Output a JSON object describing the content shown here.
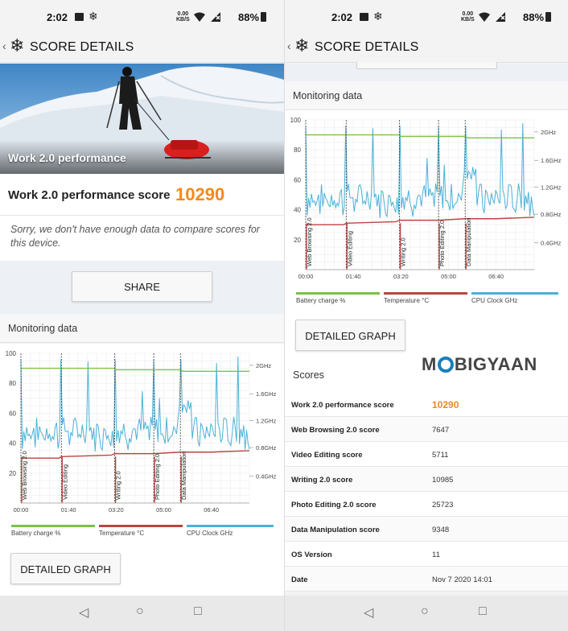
{
  "status": {
    "time": "2:02",
    "netspeed_top": "0.00",
    "netspeed_bottom": "KB/S",
    "battery": "88%"
  },
  "toolbar": {
    "title": "SCORE DETAILS"
  },
  "left": {
    "hero_caption": "Work 2.0 performance",
    "score_label": "Work 2.0 performance score",
    "score_value": "10290",
    "sorry_text": "Sorry, we don't have enough data to compare scores for this device.",
    "share_label": "SHARE",
    "monitoring_title": "Monitoring data",
    "detailed_graph_label": "DETAILED GRAPH"
  },
  "right": {
    "monitoring_title": "Monitoring data",
    "detailed_graph_label": "DETAILED GRAPH",
    "scores_title": "Scores",
    "watermark_left": "M",
    "watermark_right": "BIGYAAN",
    "rows": [
      {
        "key": "Work 2.0 performance score",
        "value": "10290"
      },
      {
        "key": "Web Browsing 2.0 score",
        "value": "7647"
      },
      {
        "key": "Video Editing score",
        "value": "5711"
      },
      {
        "key": "Writing 2.0 score",
        "value": "10985"
      },
      {
        "key": "Photo Editing 2.0 score",
        "value": "25723"
      },
      {
        "key": "Data Manipulation score",
        "value": "9348"
      },
      {
        "key": "OS Version",
        "value": "11"
      },
      {
        "key": "Date",
        "value": "Nov 7 2020 14:01"
      }
    ]
  },
  "chart_data": {
    "type": "line",
    "yticks_left": [
      "100",
      "80",
      "60",
      "40",
      "20"
    ],
    "yticks_right": [
      "2GHz",
      "1.6GHz",
      "1.2GHz",
      "0.8GHz",
      "0.4GHz"
    ],
    "xticks": [
      "00:00",
      "01:40",
      "03:20",
      "05:00",
      "06:40"
    ],
    "ylim": [
      0,
      100
    ],
    "xlim": [
      0,
      480
    ],
    "legend": [
      "Battery charge %",
      "Temperature °C",
      "CPU Clock GHz"
    ],
    "colors": {
      "battery": "#7cc246",
      "temperature": "#b94642",
      "cpu": "#4ab1d8"
    },
    "markers": [
      {
        "label": "Web Browsing 2.0",
        "x": 0
      },
      {
        "label": "Video Editing",
        "x": 85
      },
      {
        "label": "Writing 2.0",
        "x": 197
      },
      {
        "label": "Photo Editing 2.0",
        "x": 279
      },
      {
        "label": "Data Manipulation",
        "x": 335
      }
    ],
    "series": [
      {
        "name": "Battery charge %",
        "values": [
          [
            0,
            90
          ],
          [
            80,
            90
          ],
          [
            85,
            90
          ],
          [
            197,
            90
          ],
          [
            200,
            89
          ],
          [
            335,
            89
          ],
          [
            340,
            88
          ],
          [
            480,
            88
          ]
        ]
      },
      {
        "name": "Temperature °C",
        "values": [
          [
            0,
            30
          ],
          [
            80,
            30
          ],
          [
            85,
            31
          ],
          [
            190,
            32
          ],
          [
            197,
            33
          ],
          [
            279,
            33
          ],
          [
            335,
            34
          ],
          [
            400,
            34
          ],
          [
            480,
            35
          ]
        ]
      }
    ]
  }
}
